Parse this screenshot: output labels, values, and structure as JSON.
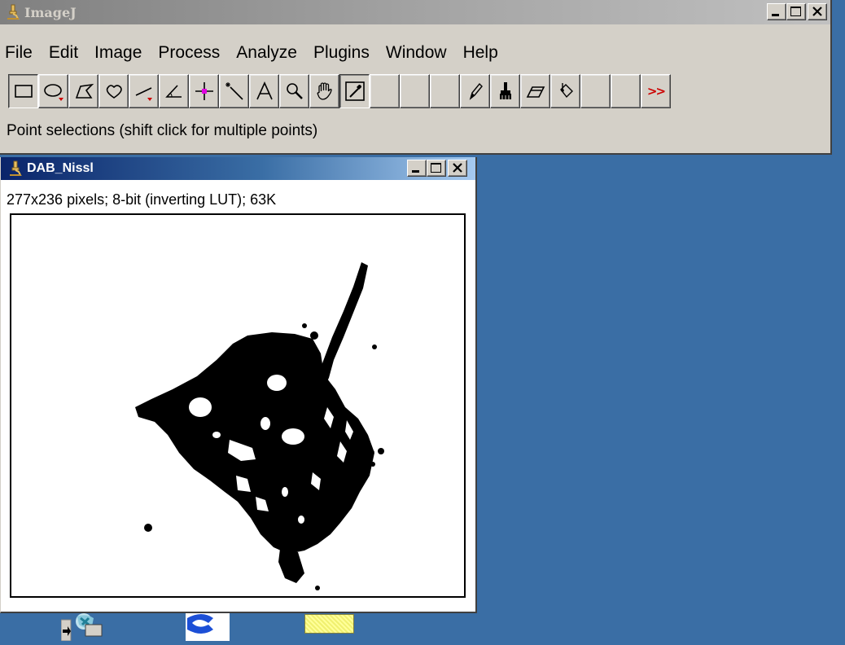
{
  "main_window": {
    "title": "ImageJ",
    "menu": [
      "File",
      "Edit",
      "Image",
      "Process",
      "Analyze",
      "Plugins",
      "Window",
      "Help"
    ],
    "tools": [
      {
        "icon": "rectangle-select-icon"
      },
      {
        "icon": "oval-select-icon"
      },
      {
        "icon": "polygon-select-icon"
      },
      {
        "icon": "freehand-select-icon"
      },
      {
        "icon": "line-tool-icon"
      },
      {
        "icon": "angle-tool-icon"
      },
      {
        "icon": "point-tool-icon"
      },
      {
        "icon": "wand-tool-icon"
      },
      {
        "icon": "text-tool-icon"
      },
      {
        "icon": "magnifier-icon"
      },
      {
        "icon": "hand-scroll-icon"
      },
      {
        "icon": "color-picker-icon"
      },
      {
        "icon": "empty-slot"
      },
      {
        "icon": "empty-slot"
      },
      {
        "icon": "empty-slot"
      },
      {
        "icon": "pencil-icon"
      },
      {
        "icon": "brush-icon"
      },
      {
        "icon": "eraser-icon"
      },
      {
        "icon": "flood-fill-icon"
      },
      {
        "icon": "empty-slot"
      },
      {
        "icon": "empty-slot"
      },
      {
        "icon": "more-tools-icon",
        "label": ">>"
      }
    ],
    "status": "Point selections (shift click for multiple points)"
  },
  "image_window": {
    "title": "DAB_Nissl",
    "info": "277x236 pixels; 8-bit (inverting LUT); 63K"
  },
  "colors": {
    "desktop": "#3a6ea5",
    "window_face": "#d4d0c8",
    "active_title_start": "#0a246a",
    "inactive_title_start": "#808080",
    "more_tools_red": "#cc0000"
  }
}
